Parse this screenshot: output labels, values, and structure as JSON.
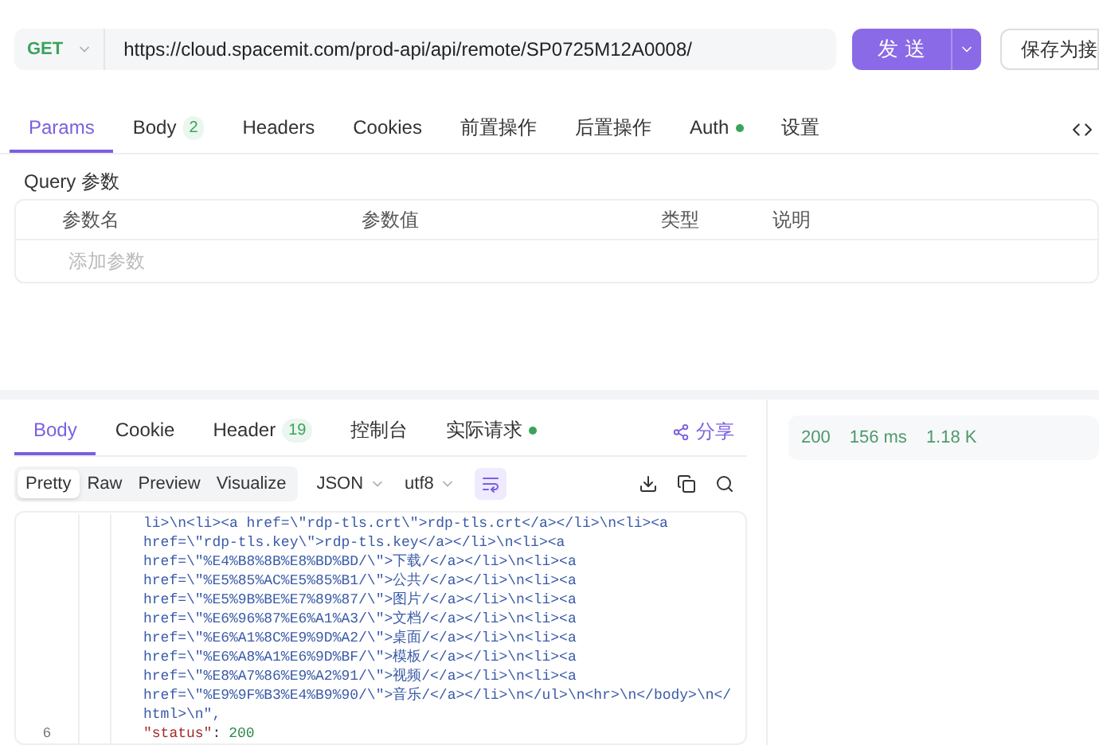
{
  "request_bar": {
    "method": "GET",
    "url": "https://cloud.spacemit.com/prod-api/api/remote/SP0725M12A0008/",
    "send": "发 送",
    "save": "保存为接"
  },
  "request_tabs": [
    {
      "label": "Params",
      "selected": true
    },
    {
      "label": "Body",
      "badge": "2",
      "selected": false
    },
    {
      "label": "Headers",
      "selected": false
    },
    {
      "label": "Cookies",
      "selected": false
    },
    {
      "label": "前置操作",
      "selected": false
    },
    {
      "label": "后置操作",
      "selected": false
    },
    {
      "label": "Auth",
      "dot": true,
      "selected": false
    },
    {
      "label": "设置",
      "selected": false
    }
  ],
  "query": {
    "title": "Query 参数",
    "columns": [
      "参数名",
      "参数值",
      "类型",
      "说明"
    ],
    "placeholder": "添加参数"
  },
  "response_tabs": [
    {
      "label": "Body",
      "selected": true
    },
    {
      "label": "Cookie",
      "selected": false
    },
    {
      "label": "Header",
      "badge": "19",
      "selected": false
    },
    {
      "label": "控制台",
      "selected": false
    },
    {
      "label": "实际请求",
      "dot": true,
      "selected": false
    }
  ],
  "share": "分享",
  "view_modes": [
    {
      "label": "Pretty",
      "selected": true
    },
    {
      "label": "Raw",
      "selected": false
    },
    {
      "label": "Preview",
      "selected": false
    },
    {
      "label": "Visualize",
      "selected": false
    }
  ],
  "format": "JSON",
  "encoding": "utf8",
  "code_lines": [
    {
      "kind": "string",
      "text": "li>\\n<li><a href=\\\"rdp-tls.crt\\\">rdp-tls.crt</a></li>\\n<li><a"
    },
    {
      "kind": "string",
      "text": "href=\\\"rdp-tls.key\\\">rdp-tls.key</a></li>\\n<li><a"
    },
    {
      "kind": "string",
      "text": "href=\\\"%E4%B8%8B%E8%BD%BD/\\\">下载/</a></li>\\n<li><a"
    },
    {
      "kind": "string",
      "text": "href=\\\"%E5%85%AC%E5%85%B1/\\\">公共/</a></li>\\n<li><a"
    },
    {
      "kind": "string",
      "text": "href=\\\"%E5%9B%BE%E7%89%87/\\\">图片/</a></li>\\n<li><a"
    },
    {
      "kind": "string",
      "text": "href=\\\"%E6%96%87%E6%A1%A3/\\\">文档/</a></li>\\n<li><a"
    },
    {
      "kind": "string",
      "text": "href=\\\"%E6%A1%8C%E9%9D%A2/\\\">桌面/</a></li>\\n<li><a"
    },
    {
      "kind": "string",
      "text": "href=\\\"%E6%A8%A1%E6%9D%BF/\\\">模板/</a></li>\\n<li><a"
    },
    {
      "kind": "string",
      "text": "href=\\\"%E8%A7%86%E9%A2%91/\\\">视频/</a></li>\\n<li><a"
    },
    {
      "kind": "string",
      "text": "href=\\\"%E9%9F%B3%E4%B9%90/\\\">音乐/</a></li>\\n</ul>\\n<hr>\\n</body>\\n</"
    },
    {
      "kind": "string",
      "text": "html>\\n\","
    },
    {
      "kind": "property",
      "line_number": "6",
      "key": "\"status\"",
      "separator": ":",
      "value": "200"
    }
  ],
  "status": {
    "code": "200",
    "time": "156 ms",
    "size": "1.18 K"
  }
}
